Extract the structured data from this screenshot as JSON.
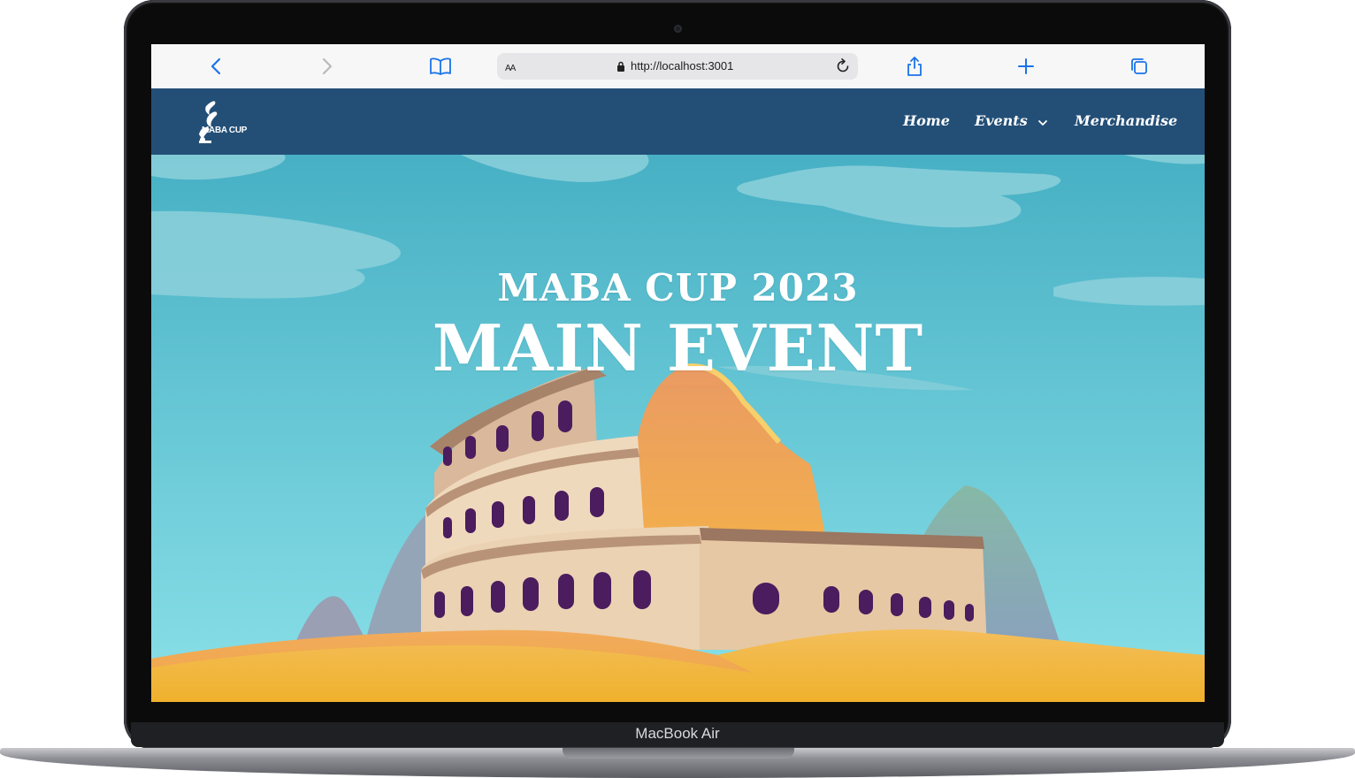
{
  "device": {
    "model_label": "MacBook Air"
  },
  "browser": {
    "text_size_label": "AA",
    "url": "http://localhost:3001",
    "icons": [
      "back-icon",
      "forward-icon",
      "bookmarks-icon",
      "lock-icon",
      "reload-icon",
      "share-icon",
      "new-tab-icon",
      "tabs-icon"
    ]
  },
  "site": {
    "logo_text": "MABA CUP",
    "nav": {
      "home": "Home",
      "events": "Events",
      "merchandise": "Merchandise"
    },
    "hero": {
      "subtitle": "MABA CUP 2023",
      "title": "MAIN EVENT"
    },
    "colors": {
      "nav_bg": "#234f77",
      "sky_top": "#47b0c4",
      "sky_bottom": "#8ae0e8",
      "sand": "#f3b743",
      "accent": "#1a73e8"
    }
  }
}
